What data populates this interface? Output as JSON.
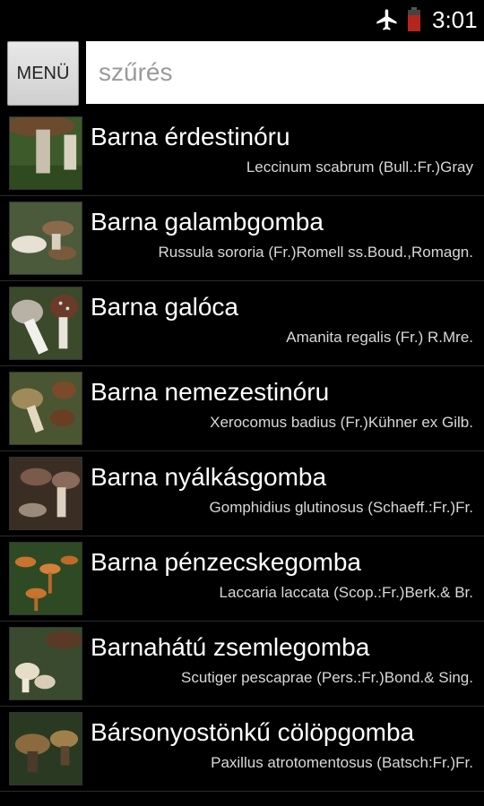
{
  "status_bar": {
    "time": "3:01",
    "icons": [
      "airplane-icon",
      "battery-icon"
    ],
    "battery_color": "#b3261e"
  },
  "header": {
    "menu_label": "MENÜ",
    "filter_placeholder": "szűrés",
    "filter_value": ""
  },
  "list": {
    "items": [
      {
        "name": "Barna érdestinóru",
        "latin": "Leccinum scabrum (Bull.:Fr.)Gray",
        "thumb": "mushroom-photo"
      },
      {
        "name": "Barna galambgomba",
        "latin": "Russula sororia (Fr.)Romell ss.Boud.,Romagn.",
        "thumb": "mushroom-photo"
      },
      {
        "name": "Barna galóca",
        "latin": "Amanita regalis (Fr.) R.Mre.",
        "thumb": "mushroom-photo"
      },
      {
        "name": "Barna nemezestinóru",
        "latin": "Xerocomus badius (Fr.)Kühner ex Gilb.",
        "thumb": "mushroom-photo"
      },
      {
        "name": "Barna nyálkásgomba",
        "latin": "Gomphidius glutinosus (Schaeff.:Fr.)Fr.",
        "thumb": "mushroom-photo"
      },
      {
        "name": "Barna pénzecskegomba",
        "latin": "Laccaria laccata (Scop.:Fr.)Berk.& Br.",
        "thumb": "mushroom-photo"
      },
      {
        "name": "Barnahátú zsemlegomba",
        "latin": "Scutiger pescaprae (Pers.:Fr.)Bond.& Sing.",
        "thumb": "mushroom-photo"
      },
      {
        "name": "Bársonyostönkű cölöpgomba",
        "latin": "Paxillus atrotomentosus (Batsch:Fr.)Fr.",
        "thumb": "mushroom-photo"
      }
    ]
  }
}
